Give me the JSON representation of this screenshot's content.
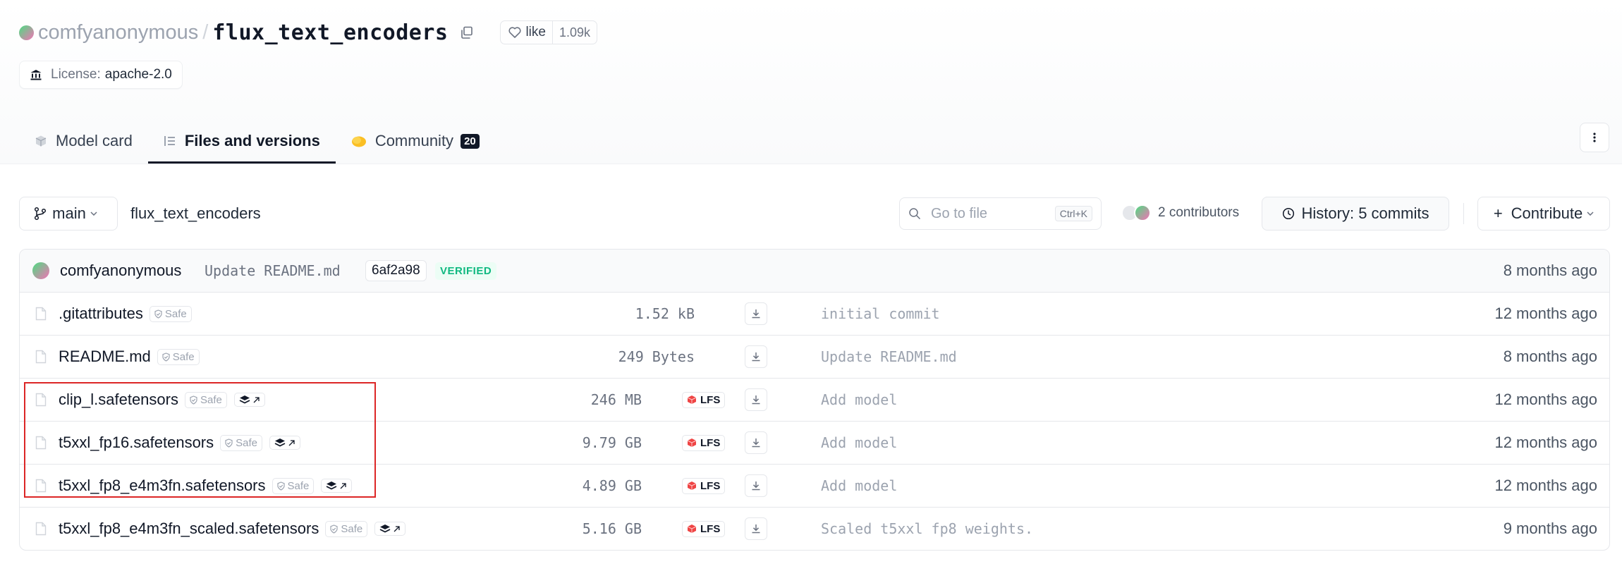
{
  "header": {
    "org": "comfyanonymous",
    "separator": "/",
    "repo": "flux_text_encoders",
    "like_label": "like",
    "like_count": "1.09k",
    "license_label": "License:",
    "license_value": "apache-2.0"
  },
  "tabs": [
    {
      "label": "Model card",
      "icon": "cube-icon",
      "active": false
    },
    {
      "label": "Files and versions",
      "icon": "files-icon",
      "active": true
    },
    {
      "label": "Community",
      "icon": "community-icon",
      "badge": "20",
      "active": false
    }
  ],
  "toolbar": {
    "branch": "main",
    "path": "flux_text_encoders",
    "search_placeholder": "Go to file",
    "search_shortcut": "Ctrl+K",
    "contributors": "2 contributors",
    "history": "History: 5 commits",
    "contribute": "Contribute"
  },
  "last_commit": {
    "author": "comfyanonymous",
    "message": "Update README.md",
    "hash": "6af2a98",
    "verified": "VERIFIED",
    "time": "8 months ago"
  },
  "files": [
    {
      "name": ".gitattributes",
      "safe": "Safe",
      "size": "1.52 kB",
      "lfs": false,
      "commit": "initial commit",
      "time": "12 months ago"
    },
    {
      "name": "README.md",
      "safe": "Safe",
      "size": "249 Bytes",
      "lfs": false,
      "commit": "Update README.md",
      "time": "8 months ago"
    },
    {
      "name": "clip_l.safetensors",
      "safe": "Safe",
      "size": "246 MB",
      "lfs": true,
      "lfs_label": "LFS",
      "commit": "Add model",
      "time": "12 months ago"
    },
    {
      "name": "t5xxl_fp16.safetensors",
      "safe": "Safe",
      "size": "9.79 GB",
      "lfs": true,
      "lfs_label": "LFS",
      "commit": "Add model",
      "time": "12 months ago"
    },
    {
      "name": "t5xxl_fp8_e4m3fn.safetensors",
      "safe": "Safe",
      "size": "4.89 GB",
      "lfs": true,
      "lfs_label": "LFS",
      "commit": "Add model",
      "time": "12 months ago"
    },
    {
      "name": "t5xxl_fp8_e4m3fn_scaled.safetensors",
      "safe": "Safe",
      "size": "5.16 GB",
      "lfs": true,
      "lfs_label": "LFS",
      "commit": "Scaled t5xxl fp8 weights.",
      "time": "9 months ago"
    }
  ],
  "colors": {
    "highlight": "#dc2626",
    "verified": "#10b981",
    "lfs_icon": "#ef4444"
  }
}
